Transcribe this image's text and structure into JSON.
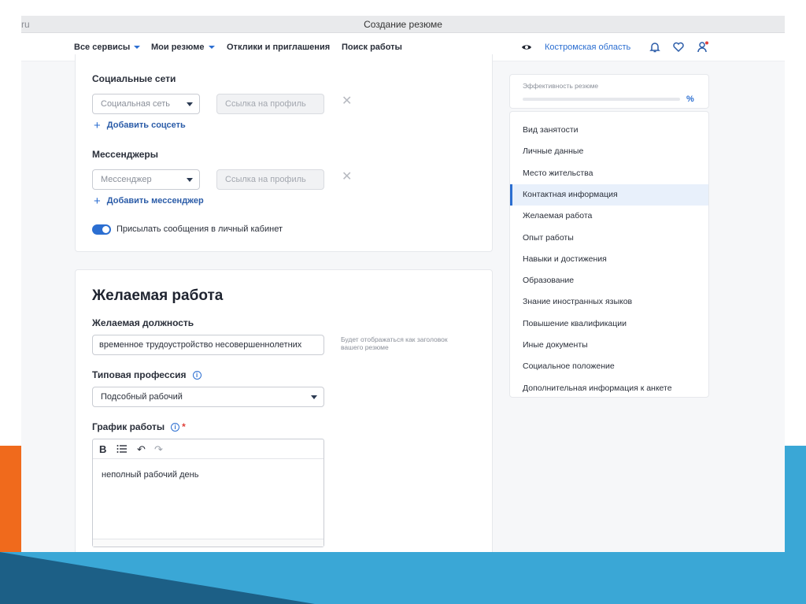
{
  "window": {
    "url": "ru",
    "title": "Создание резюме"
  },
  "nav": {
    "all_services": "Все сервисы",
    "my_resumes": "Мои резюме",
    "responses": "Отклики и приглашения",
    "job_search": "Поиск работы",
    "region": "Костромская область"
  },
  "social": {
    "label": "Социальные сети",
    "network_placeholder": "Социальная сеть",
    "link_placeholder": "Ссылка на профиль",
    "add": "Добавить соцсеть"
  },
  "messengers": {
    "label": "Мессенджеры",
    "messenger_placeholder": "Мессенджер",
    "link_placeholder": "Ссылка на профиль",
    "add": "Добавить мессенджер"
  },
  "toggle": {
    "label": "Присылать сообщения в личный кабинет",
    "checked": true
  },
  "desired_job": {
    "heading": "Желаемая работа",
    "position_label": "Желаемая должность",
    "position_value": "временное трудоустройство несовершеннолетних",
    "position_hint": "Будет отображаться как заголовок вашего резюме",
    "profession_label": "Типовая профессия",
    "profession_value": "Подсобный рабочий",
    "schedule_label": "График работы",
    "schedule_required": "*",
    "schedule_value": "неполный рабочий день"
  },
  "effectiveness": {
    "title": "Эффективность резюме",
    "percent": "%"
  },
  "sidebar_menu": [
    "Вид занятости",
    "Личные данные",
    "Место жительства",
    "Контактная информация",
    "Желаемая работа",
    "Опыт работы",
    "Навыки и достижения",
    "Образование",
    "Знание иностранных языков",
    "Повышение квалификации",
    "Иные документы",
    "Социальное положение",
    "Дополнительная информация к анкете"
  ],
  "active_menu_index": 3,
  "colors": {
    "accent": "#2b6ed1",
    "orange": "#f06a1c",
    "sky": "#3aa7d6",
    "navy": "#1c5f86"
  }
}
